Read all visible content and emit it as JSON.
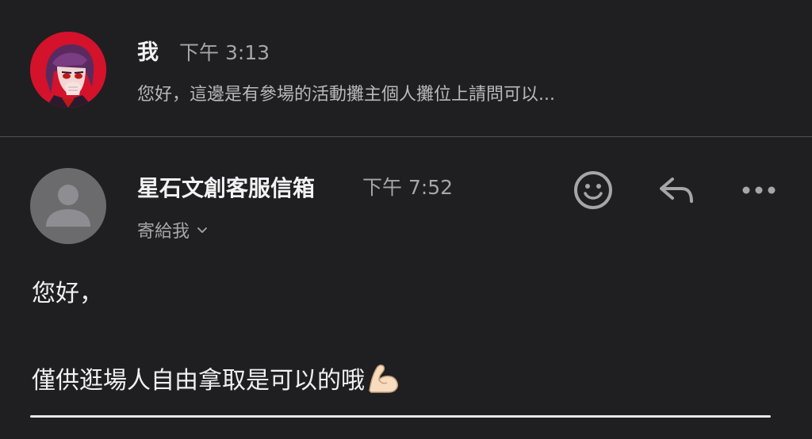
{
  "thread": [
    {
      "sender": "我",
      "time": "下午 3:13",
      "snippet": "您好，這邊是有參場的活動攤主個人攤位上請問可以..."
    },
    {
      "sender": "星石文創客服信箱",
      "time": "下午 7:52",
      "recipient": "寄給我",
      "body": {
        "greeting": "您好，",
        "text": "僅供逛場人自由拿取是可以的哦"
      },
      "body_emoji": "flexed-biceps-emoji",
      "actions": [
        "emoji-reaction-icon",
        "reply-icon",
        "more-icon"
      ]
    }
  ],
  "colors": {
    "background": "#1f1f21",
    "avatar_red": "#d4122c",
    "avatar_gray": "#6b6b6e",
    "secondary_text": "#a6a6a8"
  }
}
